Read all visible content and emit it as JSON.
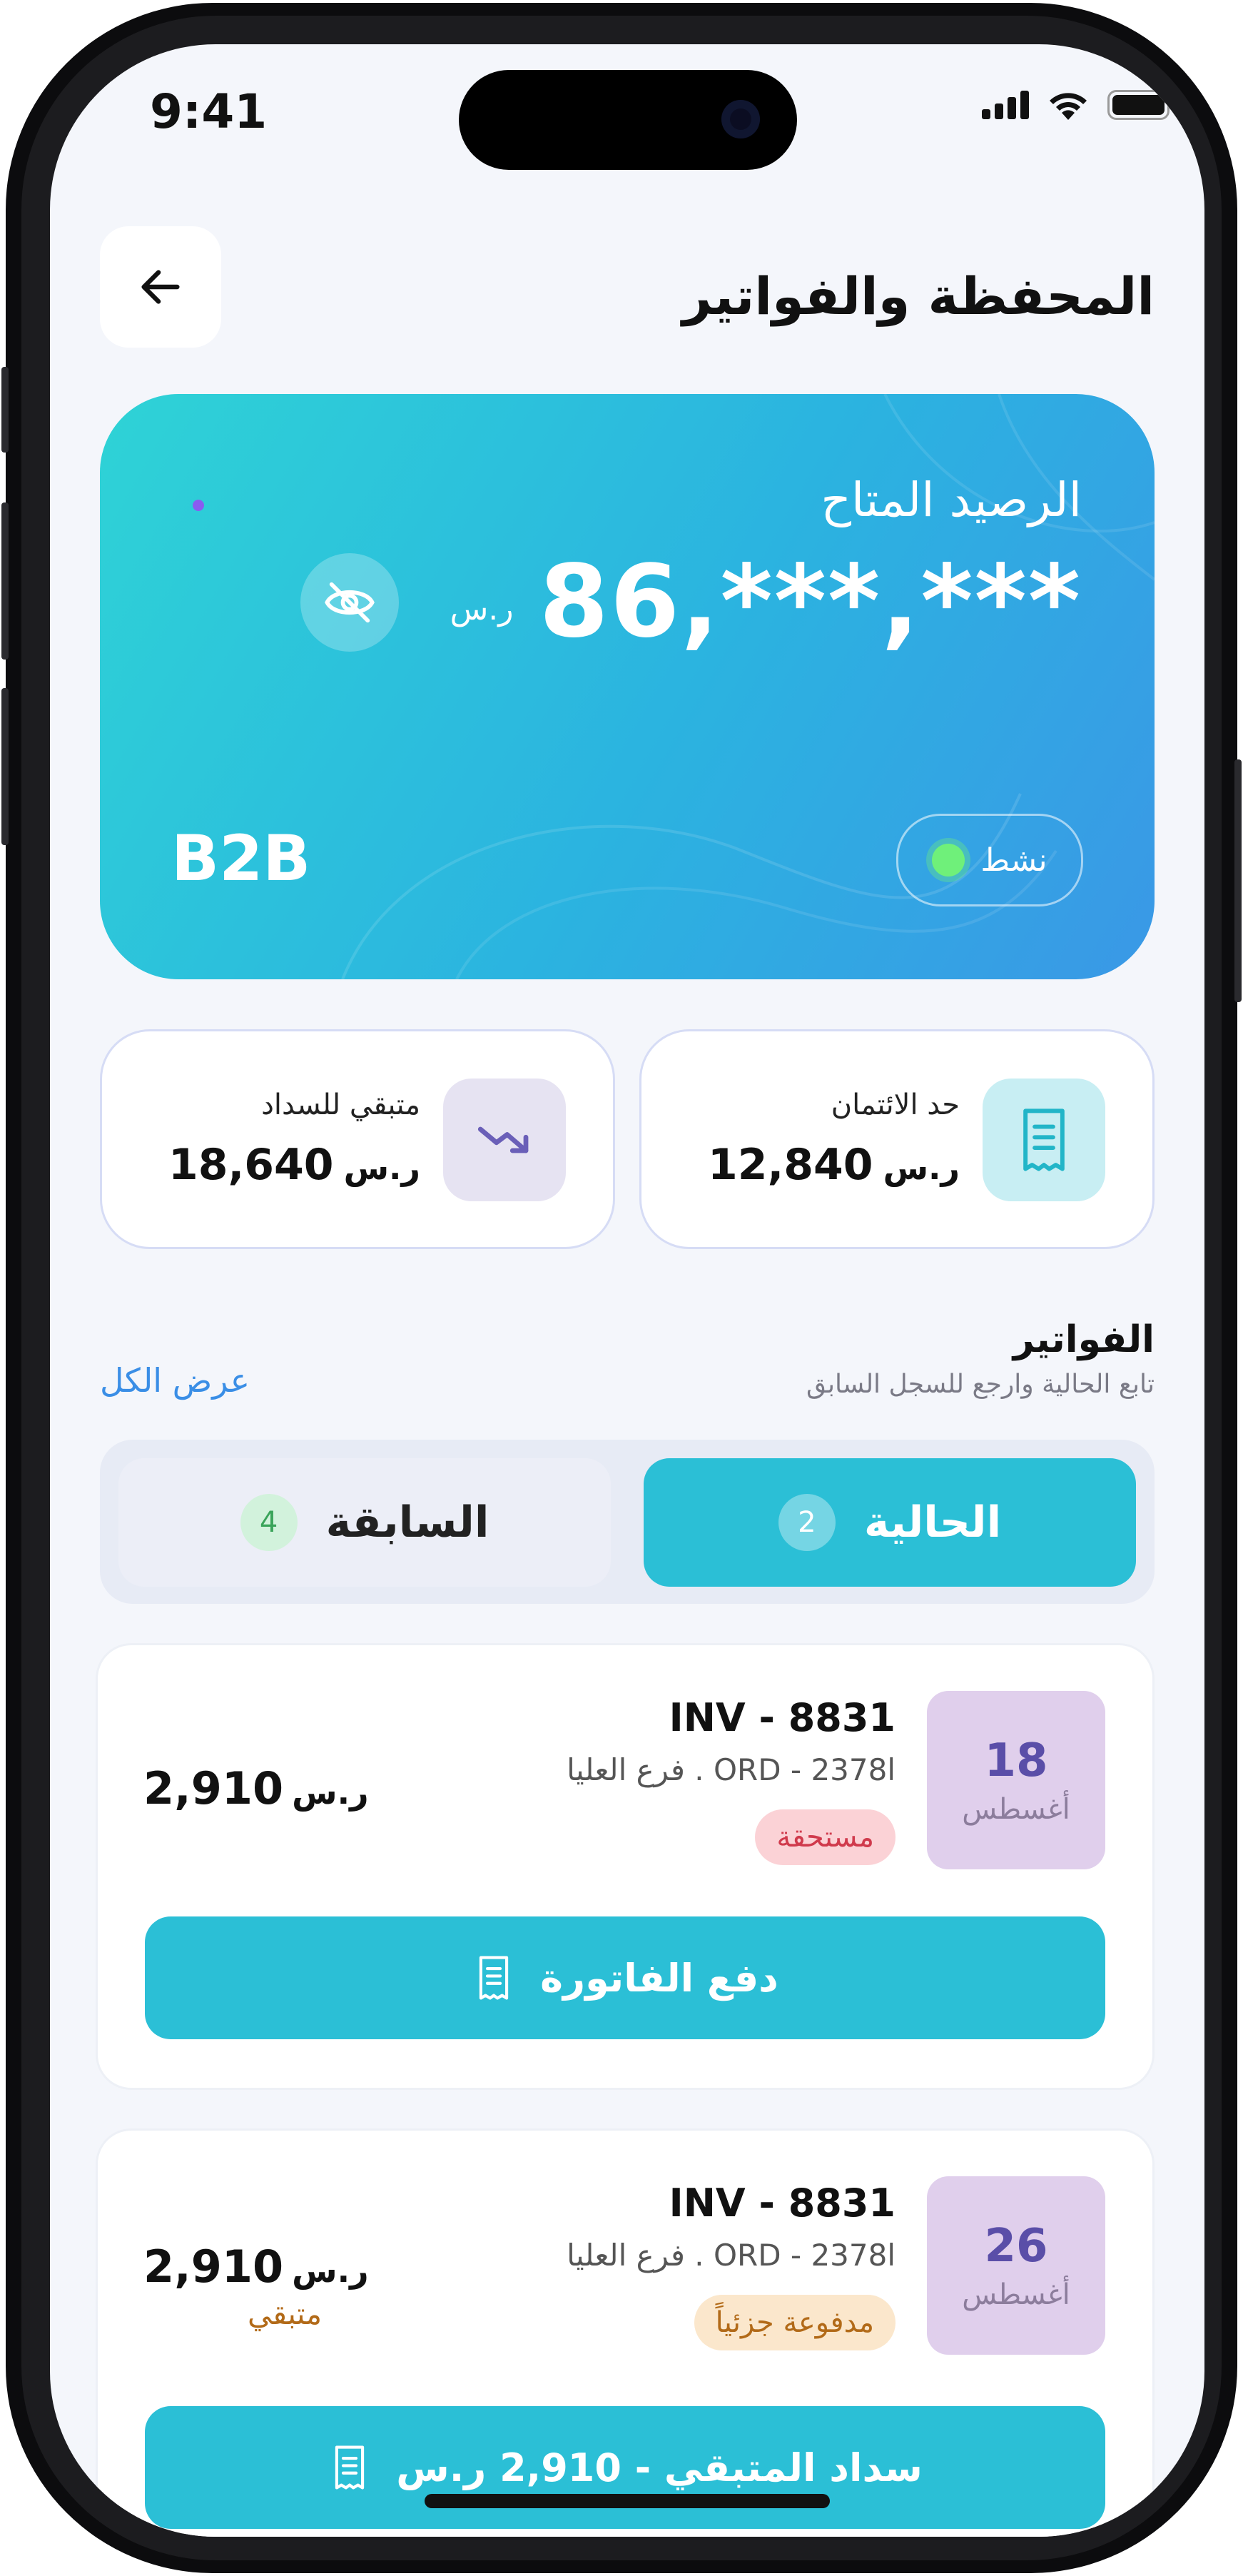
{
  "status_bar": {
    "time": "9:41"
  },
  "header": {
    "title": "المحفظة والفواتير"
  },
  "balance_card": {
    "label": "الرصيد المتاح",
    "amount": "86,***,***",
    "currency": "ر.س",
    "brand": "B2B",
    "status": "نشط"
  },
  "stats": [
    {
      "label": "حد الائتمان",
      "value": "12,840",
      "currency": "ر.س",
      "icon": "receipt-icon",
      "icon_bg": "#c8eef3"
    },
    {
      "label": "متبقي للسداد",
      "value": "18,640",
      "currency": "ر.س",
      "icon": "trend-down-icon",
      "icon_bg": "#e6e3f2"
    }
  ],
  "invoices_section": {
    "title": "الفواتير",
    "subtitle": "تابع الحالية وارجع للسجل السابق",
    "view_all": "عرض الكل"
  },
  "tabs": [
    {
      "label": "الحالية",
      "count": "2",
      "active": true
    },
    {
      "label": "السابقة",
      "count": "4",
      "active": false
    }
  ],
  "invoices": [
    {
      "day": "18",
      "month": "أغسطس",
      "number": "INV - 8831",
      "meta": "ORD - 2378l . فرع العليا",
      "status": "مستحقة",
      "amount": "2,910",
      "currency": "ر.س",
      "remaining_label": "",
      "action": "دفع الفاتورة"
    },
    {
      "day": "26",
      "month": "أغسطس",
      "number": "INV - 8831",
      "meta": "ORD - 2378l . فرع العليا",
      "status": "مدفوعة جزئياً",
      "amount": "2,910",
      "currency": "ر.س",
      "remaining_label": "متبقي",
      "action": "سداد المتبقي - 2,910 ر.س"
    }
  ],
  "colors": {
    "accent": "#2bbfd6",
    "due": "#d03a4c",
    "partial": "#b26a18",
    "link": "#3a8ee6"
  }
}
